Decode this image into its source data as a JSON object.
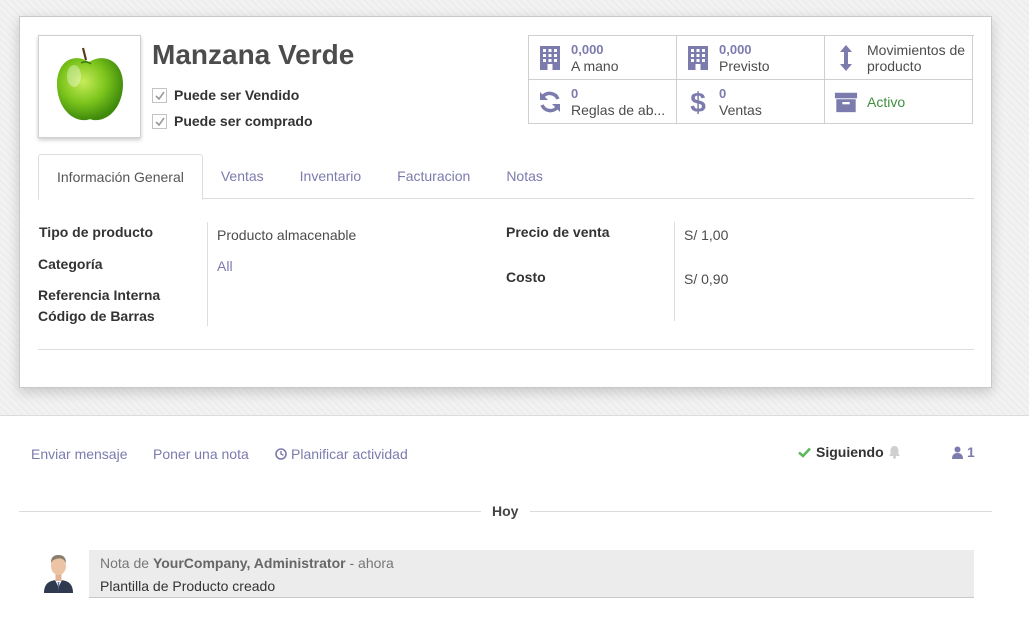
{
  "product": {
    "name": "Manzana Verde",
    "can_be_sold_label": "Puede ser Vendido",
    "can_be_sold": true,
    "can_be_purchased_label": "Puede ser comprado",
    "can_be_purchased": true
  },
  "smart_buttons": [
    {
      "icon": "building-icon",
      "value": "0,000",
      "label": "A mano"
    },
    {
      "icon": "building-icon",
      "value": "0,000",
      "label": "Previsto"
    },
    {
      "icon": "updown-arrow-icon",
      "value": "",
      "label_line1": "Movimientos de",
      "label_line2": "producto"
    },
    {
      "icon": "refresh-icon",
      "value": "0",
      "label": "Reglas de ab..."
    },
    {
      "icon": "dollar-icon",
      "value": "0",
      "label": "Ventas"
    },
    {
      "icon": "archive-icon",
      "value": "",
      "label": "Activo"
    }
  ],
  "tabs": [
    "Información General",
    "Ventas",
    "Inventario",
    "Facturacion",
    "Notas"
  ],
  "active_tab": "Información General",
  "general": {
    "product_type_label": "Tipo de producto",
    "product_type_value": "Producto almacenable",
    "category_label": "Categoría",
    "category_value": "All",
    "internal_ref_label": "Referencia Interna",
    "barcode_label": "Código de Barras",
    "sale_price_label": "Precio de venta",
    "sale_price_value": "S/ 1,00",
    "cost_label": "Costo",
    "cost_value": "S/ 0,90"
  },
  "chatter": {
    "send_message": "Enviar mensaje",
    "log_note": "Poner una nota",
    "schedule_activity": "Planificar actividad",
    "following": "Siguiendo",
    "followers_count": "1",
    "date_separator": "Hoy",
    "message": {
      "prefix": "Nota de",
      "author": "YourCompany, Administrator",
      "time": "- ahora",
      "body": "Plantilla de Producto creado"
    }
  },
  "colors": {
    "link": "#7c7bad",
    "active_green": "#3f8f3f",
    "check_green": "#5cb85c"
  }
}
